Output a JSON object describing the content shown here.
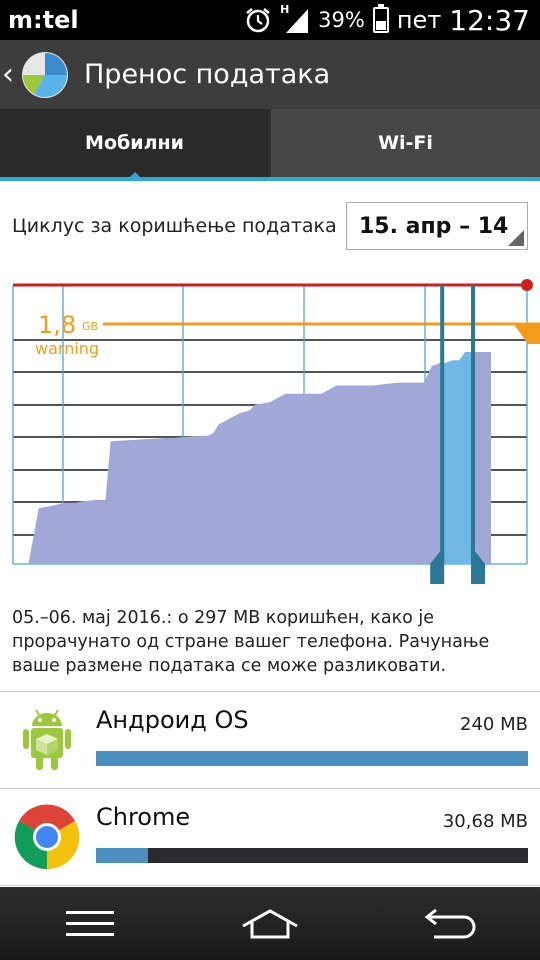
{
  "status": {
    "carrier": "m:tel",
    "network": "H",
    "battery": "39%",
    "battery_level": 0.39,
    "day": "пет",
    "time": "12:37"
  },
  "header": {
    "back_icon": "chevron-left-icon",
    "app_icon": "data-usage-pie-icon",
    "title": "Пренос података"
  },
  "tabs": [
    {
      "label": "Мобилни",
      "active": true
    },
    {
      "label": "Wi-Fi",
      "active": false
    }
  ],
  "cycle": {
    "label": "Циклус за коришћење података",
    "value": "15. апр – 14"
  },
  "chart_data": {
    "type": "area",
    "limit_value": "1,8",
    "limit_unit": "GB",
    "warning_label": "warning",
    "colors": {
      "area": "#a1a8d8",
      "selected": "#6fb8e6",
      "limit": "#cc1f1f",
      "warning": "#f39c1c",
      "handles": "#2a7896",
      "grid": "#1c1c1c",
      "vgrid": "#4aa3d8"
    },
    "x_range": [
      0,
      1
    ],
    "y_range": [
      0,
      1
    ],
    "x": [
      0.0,
      0.03,
      0.05,
      0.08,
      0.1,
      0.12,
      0.16,
      0.18,
      0.19,
      0.38,
      0.39,
      0.4,
      0.42,
      0.43,
      0.44,
      0.46,
      0.47,
      0.5,
      0.53,
      0.6,
      0.63,
      0.66,
      0.68,
      0.7,
      0.75,
      0.8,
      0.815,
      0.83,
      0.84,
      0.855,
      0.868,
      0.88,
      0.89,
      0.91,
      0.93
    ],
    "y": [
      0.0,
      0.0,
      0.2,
      0.21,
      0.22,
      0.22,
      0.23,
      0.23,
      0.44,
      0.46,
      0.47,
      0.5,
      0.52,
      0.53,
      0.54,
      0.55,
      0.57,
      0.58,
      0.61,
      0.61,
      0.64,
      0.64,
      0.64,
      0.64,
      0.65,
      0.65,
      0.71,
      0.72,
      0.72,
      0.73,
      0.73,
      0.76,
      0.76,
      0.76,
      0.76
    ],
    "selection": [
      0.835,
      0.895
    ],
    "warning_level": 0.86
  },
  "description": "05.–06. мај 2016.: о 297 MB коришћен, како је прорачунато од стране вашег телефона. Рачунање ваше размене података се може разликовати.",
  "apps": [
    {
      "icon": "android-icon",
      "name": "Андроид OS",
      "size": "240 MB",
      "fraction": 1.0
    },
    {
      "icon": "chrome-icon",
      "name": "Chrome",
      "size": "30,68 MB",
      "fraction": 0.12
    }
  ],
  "nav": {
    "menu_icon": "menu-icon",
    "home_icon": "home-icon",
    "back_icon": "back-arrow-icon"
  }
}
